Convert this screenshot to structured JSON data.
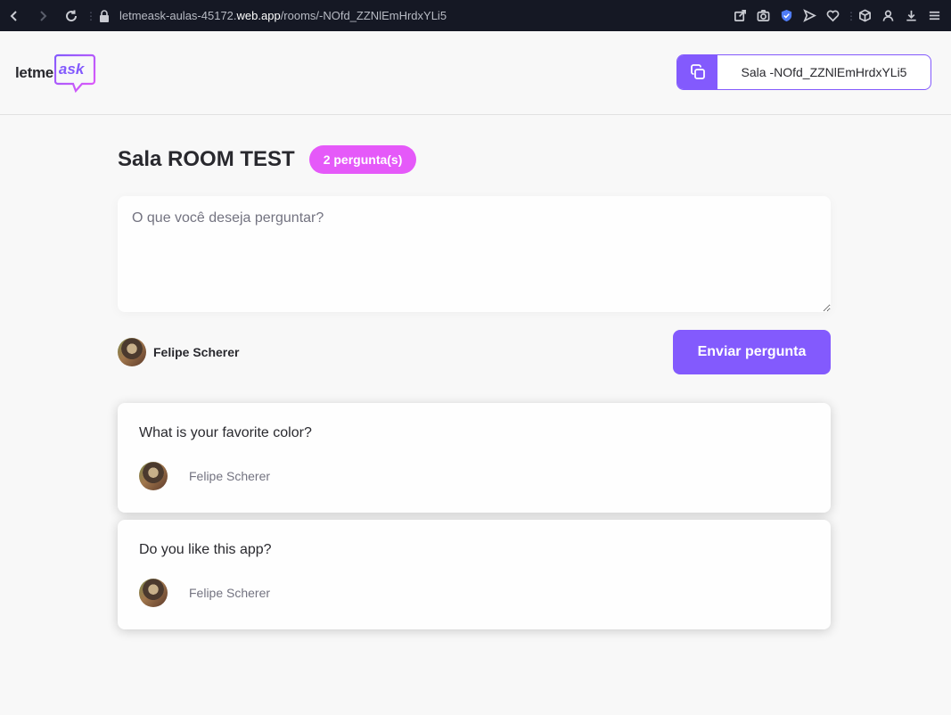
{
  "browser": {
    "url_prefix": "letmeask-aulas-45172.",
    "url_domain": "web.app",
    "url_path": "/rooms/-NOfd_ZZNlEmHrdxYLi5"
  },
  "header": {
    "logo_text": "letme",
    "logo_accent": "ask",
    "room_code_label": "Sala -NOfd_ZZNlEmHrdxYLi5"
  },
  "room": {
    "title": "Sala ROOM TEST",
    "question_count": "2 pergunta(s)"
  },
  "form": {
    "placeholder": "O que você deseja perguntar?",
    "user_name": "Felipe Scherer",
    "submit_label": "Enviar pergunta"
  },
  "questions": [
    {
      "content": "What is your favorite color?",
      "author": "Felipe Scherer"
    },
    {
      "content": "Do you like this app?",
      "author": "Felipe Scherer"
    }
  ],
  "colors": {
    "primary": "#835afd",
    "badge": "#e559f9",
    "background": "#f8f8f8",
    "browser_bar": "#151824"
  }
}
